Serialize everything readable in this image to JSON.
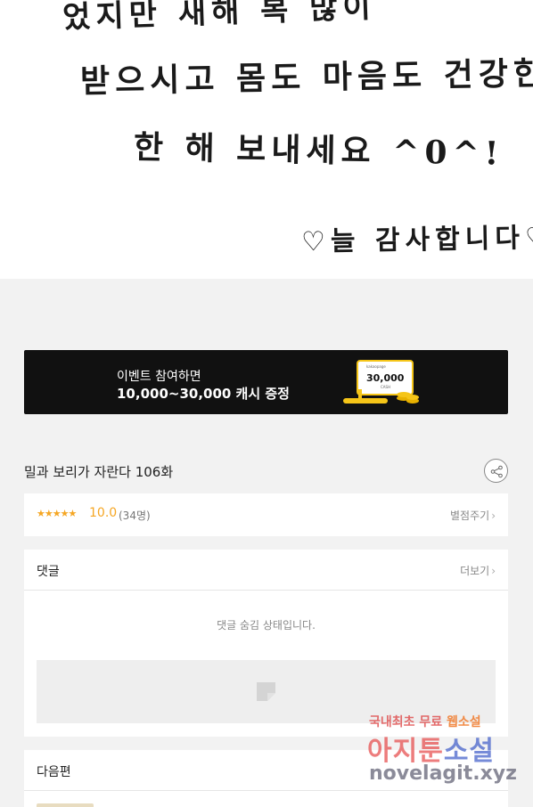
{
  "comic_panel": {
    "line1": "었지만    새해 복  많이",
    "line2": "받으시고   몸도 마음도  건강한",
    "line3": "한  해  보내세요 ^0^!",
    "line4": "♡늘 감사합니다♡"
  },
  "event_banner": {
    "line1": "이벤트 참여하면",
    "line2": "10,000~30,000 캐시 증정",
    "art_brand": "kakaopage",
    "art_amount": "30,000",
    "art_unit": "CASH"
  },
  "episode": {
    "title": "밀과 보리가 자란다 106화"
  },
  "rating": {
    "stars": "★★★★★",
    "score": "10.0",
    "count": "(34명)",
    "rate_label": "별점주기",
    "chevron": "›"
  },
  "comments": {
    "title": "댓글",
    "more_label": "더보기",
    "chevron": "›",
    "hidden_message": "댓글 숨김 상태입니다."
  },
  "next_episode": {
    "title": "다음편"
  },
  "watermark": {
    "line1_a": "국내최초 무료 ",
    "line1_b": "웹소설",
    "line2_a": "아지툰",
    "line2_b": "소설",
    "line3": "novelagit.xyz"
  },
  "colors": {
    "star": "#f5a623",
    "banner_bg": "#111111",
    "page_bg": "#f2f2f2"
  },
  "icons": {
    "share": "share-icon",
    "placeholder": "image-placeholder-icon"
  }
}
